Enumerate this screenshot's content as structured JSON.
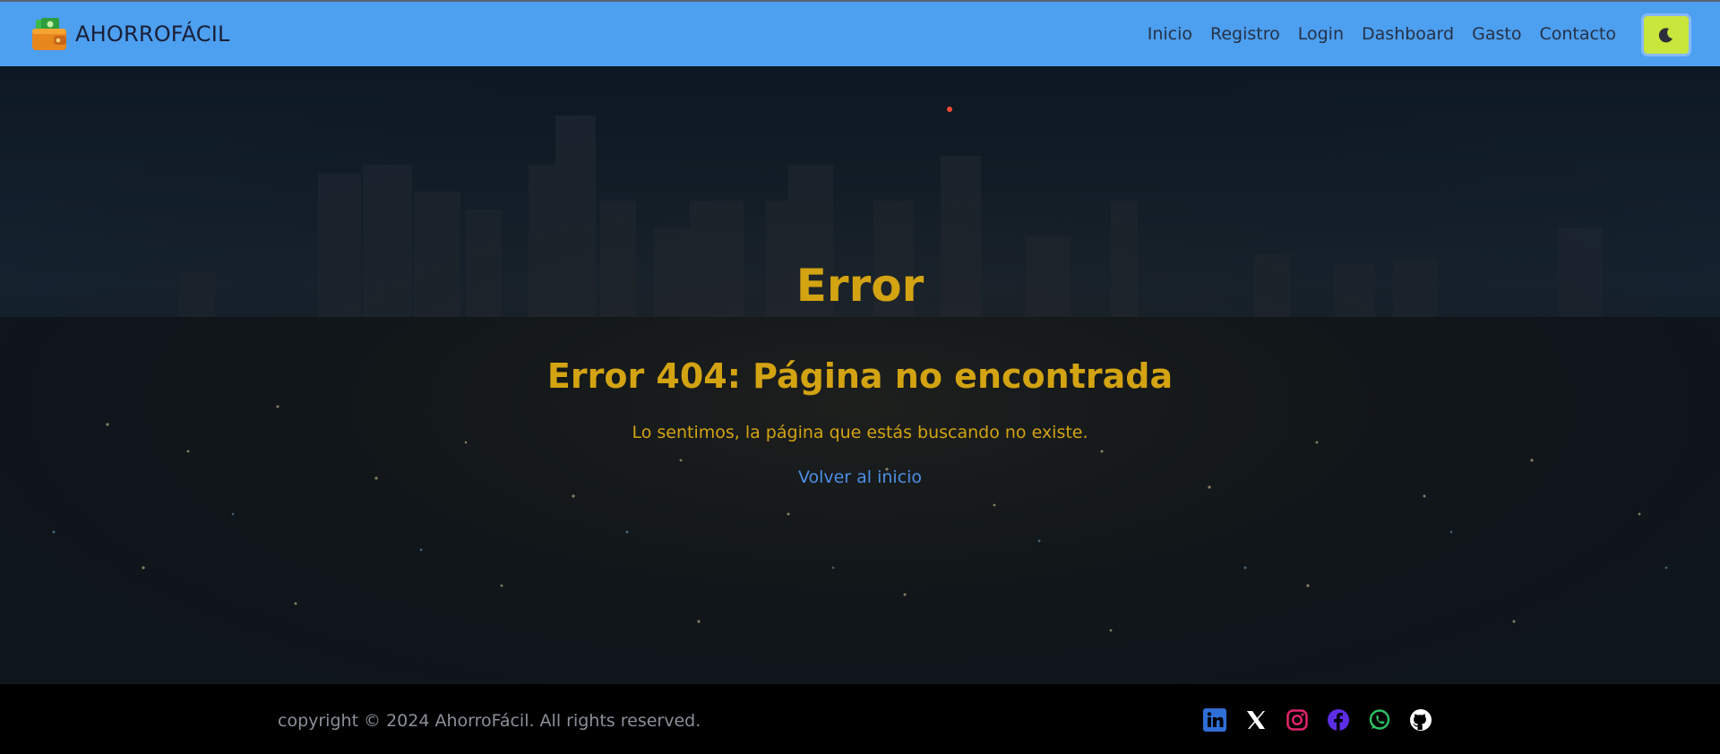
{
  "navbar": {
    "brand": "AHORROFÁCIL",
    "links": [
      "Inicio",
      "Registro",
      "Login",
      "Dashboard",
      "Gasto",
      "Contacto"
    ],
    "theme_toggle_icon": "moon-icon",
    "colors": {
      "bar": "#4d9ff0",
      "toggle": "#c8e63c"
    }
  },
  "main": {
    "title": "Error",
    "subtitle": "Error 404: Página no encontrada",
    "message": "Lo sentimos, la página que estás buscando no existe.",
    "back_link": "Volver al inicio",
    "colors": {
      "heading": "#d3a312",
      "link": "#4d8fe6"
    }
  },
  "footer": {
    "copyright": "copyright © 2024 AhorroFácil. All rights reserved.",
    "social_icons": [
      "linkedin-icon",
      "x-icon",
      "instagram-icon",
      "facebook-icon",
      "whatsapp-icon",
      "github-icon"
    ]
  }
}
